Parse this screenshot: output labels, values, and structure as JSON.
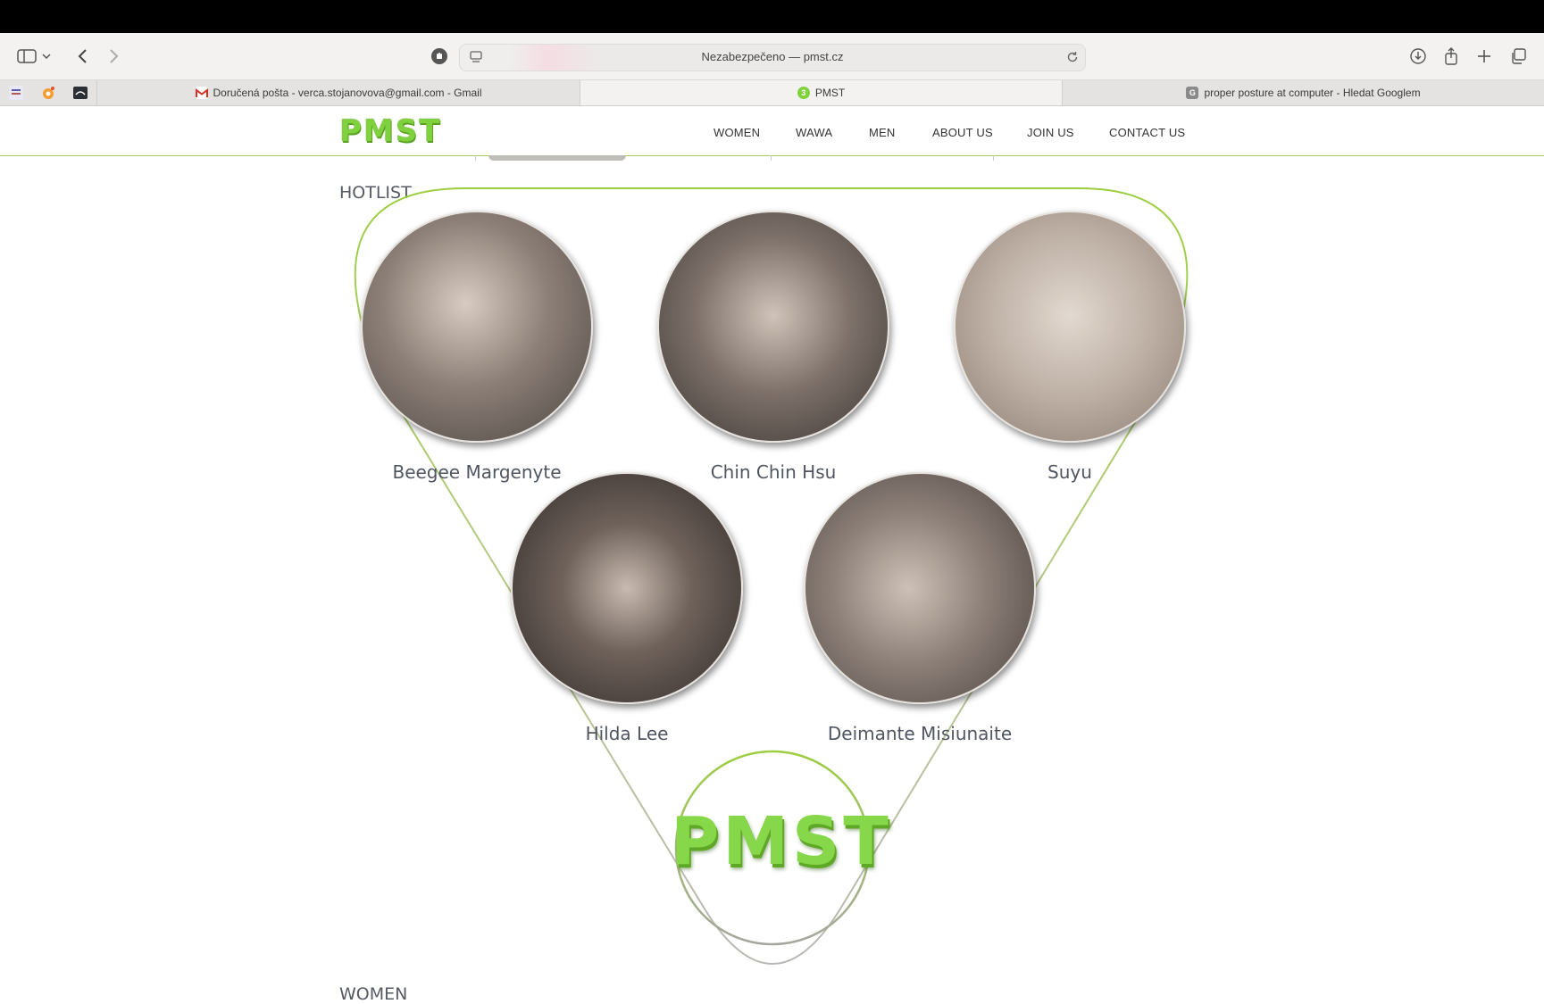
{
  "browser": {
    "address": "Nezabezpečeno — pmst.cz",
    "tabs": [
      {
        "title": "Doručená pošta - verca.stojanovova@gmail.com - Gmail",
        "icon": "gmail-icon"
      },
      {
        "title": "PMST",
        "icon": "pmst-favicon",
        "badge": "3"
      },
      {
        "title": "proper posture at computer - Hledat Googlem",
        "icon": "google-icon",
        "badge": "G"
      }
    ]
  },
  "site": {
    "logo": "PMST",
    "nav": [
      "WOMEN",
      "WAWA",
      "MEN",
      "ABOUT US",
      "JOIN US",
      "CONTACT US"
    ],
    "accent": "#8cc63f"
  },
  "hotlist": {
    "title": "HOTLIST",
    "models": [
      {
        "name": "Beegee Margenyte"
      },
      {
        "name": "Chin Chin Hsu"
      },
      {
        "name": "Suyu"
      },
      {
        "name": "Hilda Lee"
      },
      {
        "name": "Deimante Misiunaite"
      }
    ],
    "center_logo": "PMST"
  },
  "next_section": {
    "title": "WOMEN"
  }
}
